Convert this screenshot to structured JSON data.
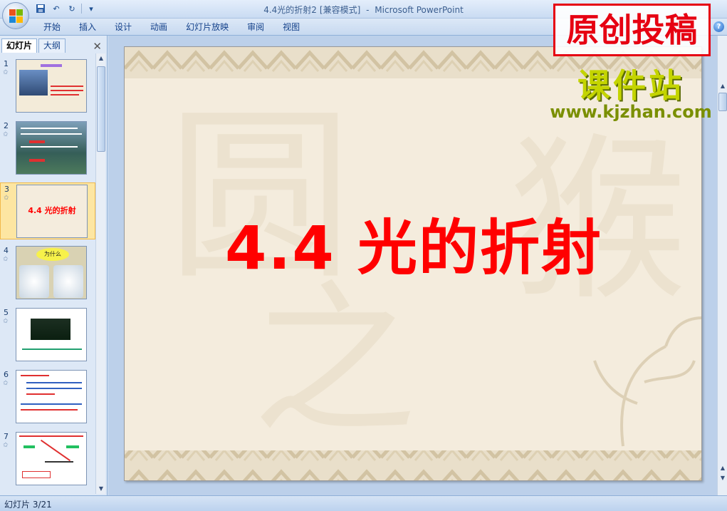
{
  "window": {
    "title_file": "4.4光的折射2",
    "title_mode": "[兼容模式]",
    "title_sep": "-",
    "title_app": "Microsoft PowerPoint"
  },
  "ribbon": {
    "tabs": [
      {
        "label": "开始"
      },
      {
        "label": "插入"
      },
      {
        "label": "设计"
      },
      {
        "label": "动画"
      },
      {
        "label": "幻灯片放映"
      },
      {
        "label": "审阅"
      },
      {
        "label": "视图"
      }
    ],
    "help_label": "?"
  },
  "panel": {
    "tab_slides": "幻灯片",
    "tab_outline": "大纲",
    "close_label": "✕"
  },
  "slides": [
    {
      "num": "1"
    },
    {
      "num": "2"
    },
    {
      "num": "3",
      "text": "4.4 光的折射"
    },
    {
      "num": "4",
      "bubble": "为什么"
    },
    {
      "num": "5"
    },
    {
      "num": "6"
    },
    {
      "num": "7"
    }
  ],
  "slide": {
    "title": "4.4 光的折射"
  },
  "watermark": {
    "box_text": "原创投稿",
    "site_name": "课件站",
    "site_url": "www.kjzhan.com"
  },
  "status": {
    "text": "幻灯片 3/21"
  },
  "colors": {
    "title_red": "#ff0000",
    "watermark_red": "#e60012",
    "site_green": "#c4d400"
  }
}
